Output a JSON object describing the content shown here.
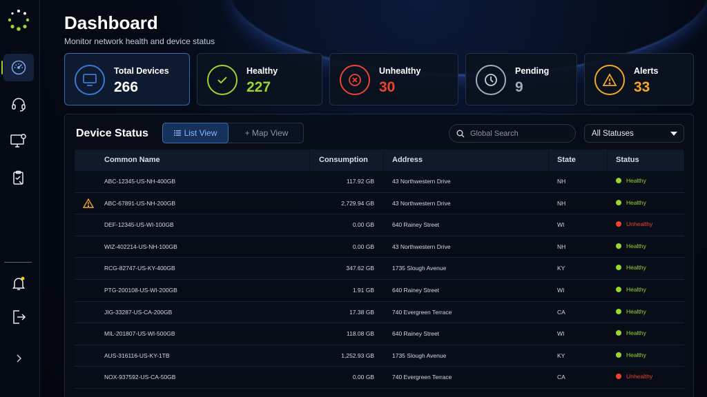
{
  "colors": {
    "accent": "#3a6bb0",
    "healthy": "#9bd62f",
    "unhealthy": "#f0432f",
    "pending": "#a4acb8",
    "alerts": "#f5a623",
    "devices": "#3a7ad6"
  },
  "header": {
    "title": "Dashboard",
    "subtitle": "Monitor network health and device status"
  },
  "sidebar": {
    "items": [
      {
        "icon": "speedometer-icon",
        "active": true
      },
      {
        "icon": "headset-icon",
        "active": false
      },
      {
        "icon": "monitor-settings-icon",
        "active": false
      },
      {
        "icon": "clipboard-tools-icon",
        "active": false
      },
      {
        "icon": "notification-bell-icon",
        "active": false
      },
      {
        "icon": "logout-icon",
        "active": false
      },
      {
        "icon": "chevron-right-icon",
        "active": false
      }
    ]
  },
  "cards": [
    {
      "label": "Total Devices",
      "value": "266",
      "icon": "monitor-icon",
      "color": "#3a7ad6"
    },
    {
      "label": "Healthy",
      "value": "227",
      "icon": "check-icon",
      "color": "#9bd62f"
    },
    {
      "label": "Unhealthy",
      "value": "30",
      "icon": "x-circle-icon",
      "color": "#f0432f"
    },
    {
      "label": "Pending",
      "value": "9",
      "icon": "clock-icon",
      "color": "#a4acb8"
    },
    {
      "label": "Alerts",
      "value": "33",
      "icon": "warning-icon",
      "color": "#f5a623"
    }
  ],
  "panel": {
    "title": "Device Status",
    "list_view": "List View",
    "map_view": "+ Map View",
    "search_placeholder": "Global Search",
    "status_filter": "All Statuses"
  },
  "table": {
    "headers": [
      "Common Name",
      "Consumption",
      "Address",
      "State",
      "Status"
    ],
    "rows": [
      {
        "warning": false,
        "name": "ABC-12345-US-NH-400GB",
        "consumption": "117.92 GB",
        "address": "43 Northwestern Drive",
        "state": "NH",
        "status": "Healthy"
      },
      {
        "warning": true,
        "name": "ABC-67891-US-NH-200GB",
        "consumption": "2,729.94 GB",
        "address": "43 Northwestern Drive",
        "state": "NH",
        "status": "Healthy"
      },
      {
        "warning": false,
        "name": "DEF-12345-US-WI-100GB",
        "consumption": "0.00 GB",
        "address": "640 Rainey Street",
        "state": "WI",
        "status": "Unhealthy"
      },
      {
        "warning": false,
        "name": "WIZ-402214-US-NH-100GB",
        "consumption": "0.00 GB",
        "address": "43 Northwestern Drive",
        "state": "NH",
        "status": "Healthy"
      },
      {
        "warning": false,
        "name": "RCG-82747-US-KY-400GB",
        "consumption": "347.62 GB",
        "address": "1735 Slough Avenue",
        "state": "KY",
        "status": "Healthy"
      },
      {
        "warning": false,
        "name": "PTG-200108-US-WI-200GB",
        "consumption": "1.91 GB",
        "address": "640 Rainey Street",
        "state": "WI",
        "status": "Healthy"
      },
      {
        "warning": false,
        "name": "JIG-33287-US-CA-200GB",
        "consumption": "17.38 GB",
        "address": "740 Evergreen Terrace",
        "state": "CA",
        "status": "Healthy"
      },
      {
        "warning": false,
        "name": "MIL-201807-US-WI-500GB",
        "consumption": "118.08 GB",
        "address": "640 Rainey Street",
        "state": "WI",
        "status": "Healthy"
      },
      {
        "warning": false,
        "name": "AUS-316116-US-KY-1TB",
        "consumption": "1,252.93 GB",
        "address": "1735 Slough Avenue",
        "state": "KY",
        "status": "Healthy"
      },
      {
        "warning": false,
        "name": "NOX-937592-US-CA-50GB",
        "consumption": "0.00 GB",
        "address": "740 Evergreen Terrace",
        "state": "CA",
        "status": "Unhealthy"
      }
    ]
  }
}
